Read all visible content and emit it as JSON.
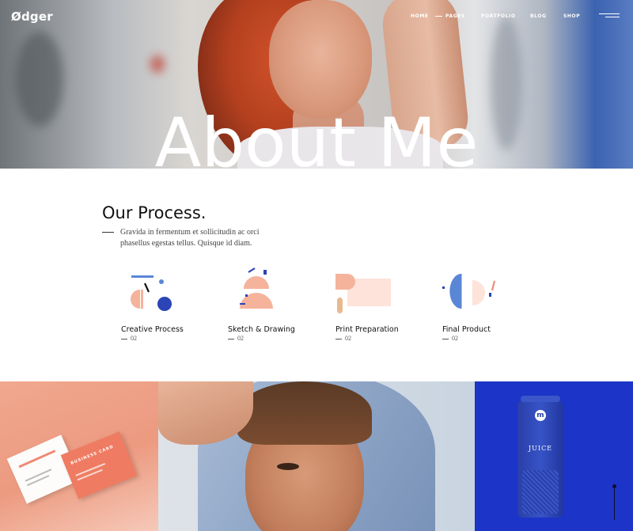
{
  "brand": {
    "logo": "Ødger"
  },
  "nav": {
    "items": [
      "HOME",
      "PAGES",
      "PORTFOLIO",
      "BLOG",
      "SHOP"
    ]
  },
  "hero": {
    "title": "About Me"
  },
  "process": {
    "title": "Our Process.",
    "text": "Gravida in fermentum et sollicitudin ac orci phasellus egestas tellus. Quisque id diam.",
    "steps": [
      {
        "label": "Creative Process",
        "num": "02"
      },
      {
        "label": "Sketch & Drawing",
        "num": "02"
      },
      {
        "label": "Print Preparation",
        "num": "02"
      },
      {
        "label": "Final Product",
        "num": "02"
      }
    ]
  },
  "gallery": {
    "cards_text": "BUSINESS CARD",
    "juice_label": "JUICE",
    "juice_logo": "m"
  },
  "colors": {
    "peach": "#f5b39c",
    "light_peach": "#fde3da",
    "blue": "#2b44b6",
    "mid_blue": "#5a86d6",
    "coral": "#ef8a73",
    "tan": "#e9b98e",
    "juice_bg": "#1c34c8"
  }
}
